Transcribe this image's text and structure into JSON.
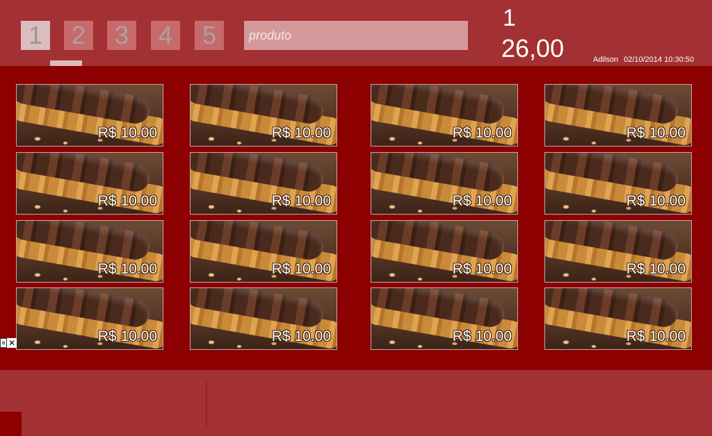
{
  "tabs": [
    {
      "label": "1",
      "active": true
    },
    {
      "label": "2",
      "active": false
    },
    {
      "label": "3",
      "active": false
    },
    {
      "label": "4",
      "active": false
    },
    {
      "label": "5",
      "active": false
    }
  ],
  "search": {
    "placeholder": "produto",
    "value": ""
  },
  "order": {
    "quantity": "1",
    "total": "26,00"
  },
  "user": {
    "name": "Adilson",
    "datetime": "02/10/2014 10:30:50"
  },
  "products": [
    {
      "price": "R$ 10.00"
    },
    {
      "price": "R$ 10.00"
    },
    {
      "price": "R$ 10.00"
    },
    {
      "price": "R$ 10.00"
    },
    {
      "price": "R$ 10.00"
    },
    {
      "price": "R$ 10.00"
    },
    {
      "price": "R$ 10.00"
    },
    {
      "price": "R$ 10.00"
    },
    {
      "price": "R$ 10.00"
    },
    {
      "price": "R$ 10.00"
    },
    {
      "price": "R$ 10.00"
    },
    {
      "price": "R$ 10.00"
    },
    {
      "price": "R$ 10.00"
    },
    {
      "price": "R$ 10.00"
    },
    {
      "price": "R$ 10.00"
    },
    {
      "price": "R$ 10.00"
    }
  ],
  "mini_tool": {
    "box_label": "a",
    "close_label": "✕"
  },
  "colors": {
    "background": "#a33032",
    "panel": "#8c0002",
    "tab_active": "#dcbcbc",
    "tab": "#c86a6c",
    "search": "#d6999b"
  },
  "icons": {
    "product_image": "churros-product-image",
    "close": "close-icon"
  }
}
